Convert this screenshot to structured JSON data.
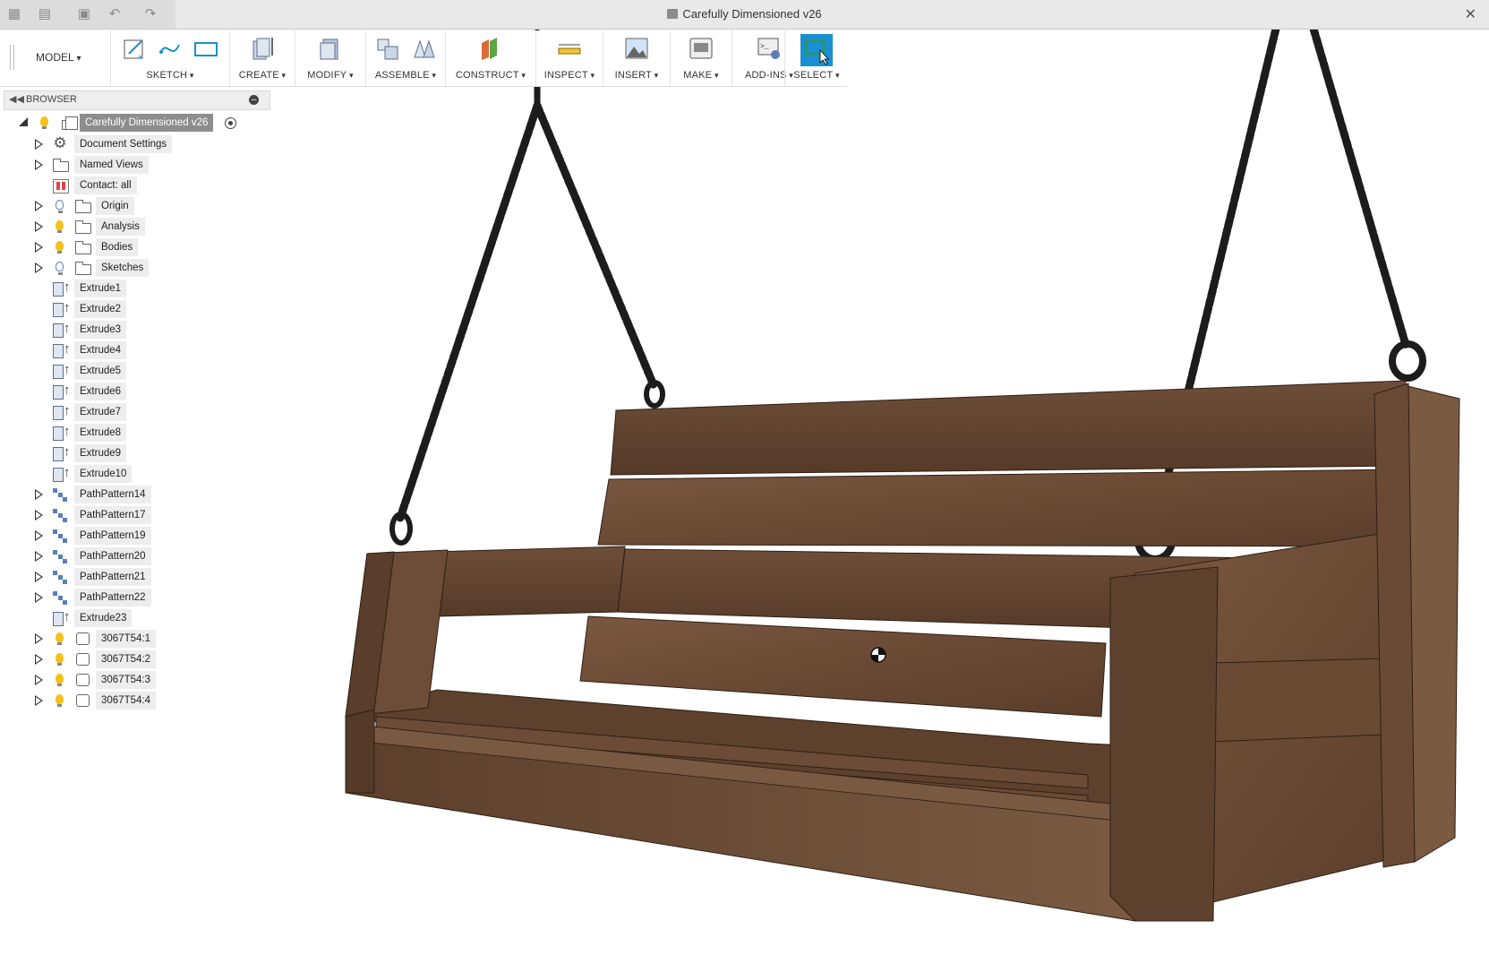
{
  "titlebar": {
    "document_title": "Carefully Dimensioned v26",
    "icons": [
      "apps-grid-icon",
      "file-icon",
      "save-icon",
      "undo-icon",
      "redo-icon",
      "close-icon"
    ]
  },
  "toolbar": {
    "workspace": "MODEL",
    "groups": [
      {
        "label": "SKETCH",
        "icons": [
          "create-sketch-icon",
          "spline-icon",
          "rectangle-icon"
        ]
      },
      {
        "label": "CREATE",
        "icons": [
          "extrude-icon"
        ]
      },
      {
        "label": "MODIFY",
        "icons": [
          "press-pull-icon"
        ]
      },
      {
        "label": "ASSEMBLE",
        "icons": [
          "new-component-icon",
          "joint-icon"
        ]
      },
      {
        "label": "CONSTRUCT",
        "icons": [
          "offset-plane-icon"
        ]
      },
      {
        "label": "INSPECT",
        "icons": [
          "measure-icon"
        ]
      },
      {
        "label": "INSERT",
        "icons": [
          "insert-image-icon"
        ]
      },
      {
        "label": "MAKE",
        "icons": [
          "3d-print-icon"
        ]
      },
      {
        "label": "ADD-INS",
        "icons": [
          "scripts-icon"
        ]
      },
      {
        "label": "SELECT",
        "icons": [
          "select-icon"
        ]
      }
    ],
    "accent_color": "#1a8fd1"
  },
  "browser": {
    "title": "BROWSER",
    "root": "Carefully Dimensioned v26",
    "items": [
      {
        "label": "Document Settings",
        "icon": "gear-icon"
      },
      {
        "label": "Named Views",
        "icon": "folder-icon"
      },
      {
        "label": "Contact: all",
        "icon": "contact-set-icon"
      },
      {
        "label": "Origin",
        "icon": "folder-icon"
      },
      {
        "label": "Analysis",
        "icon": "folder-icon"
      },
      {
        "label": "Bodies",
        "icon": "folder-icon"
      },
      {
        "label": "Sketches",
        "icon": "folder-icon"
      },
      {
        "label": "Extrude1",
        "icon": "extrude-icon"
      },
      {
        "label": "Extrude2",
        "icon": "extrude-icon"
      },
      {
        "label": "Extrude3",
        "icon": "extrude-icon"
      },
      {
        "label": "Extrude4",
        "icon": "extrude-icon"
      },
      {
        "label": "Extrude5",
        "icon": "extrude-icon"
      },
      {
        "label": "Extrude6",
        "icon": "extrude-icon"
      },
      {
        "label": "Extrude7",
        "icon": "extrude-icon"
      },
      {
        "label": "Extrude8",
        "icon": "extrude-icon"
      },
      {
        "label": "Extrude9",
        "icon": "extrude-icon"
      },
      {
        "label": "Extrude10",
        "icon": "extrude-icon"
      },
      {
        "label": "PathPattern14",
        "icon": "pattern-icon"
      },
      {
        "label": "PathPattern17",
        "icon": "pattern-icon"
      },
      {
        "label": "PathPattern19",
        "icon": "pattern-icon"
      },
      {
        "label": "PathPattern20",
        "icon": "pattern-icon"
      },
      {
        "label": "PathPattern21",
        "icon": "pattern-icon"
      },
      {
        "label": "PathPattern22",
        "icon": "pattern-icon"
      },
      {
        "label": "Extrude23",
        "icon": "extrude-icon"
      },
      {
        "label": "3067T54:1",
        "icon": "component-icon"
      },
      {
        "label": "3067T54:2",
        "icon": "component-icon"
      },
      {
        "label": "3067T54:3",
        "icon": "component-icon"
      },
      {
        "label": "3067T54:4",
        "icon": "component-icon"
      }
    ]
  },
  "viewport": {
    "model": "porch-swing",
    "wood_color": "#6b4a34",
    "chain_color": "#1c1c1c"
  }
}
